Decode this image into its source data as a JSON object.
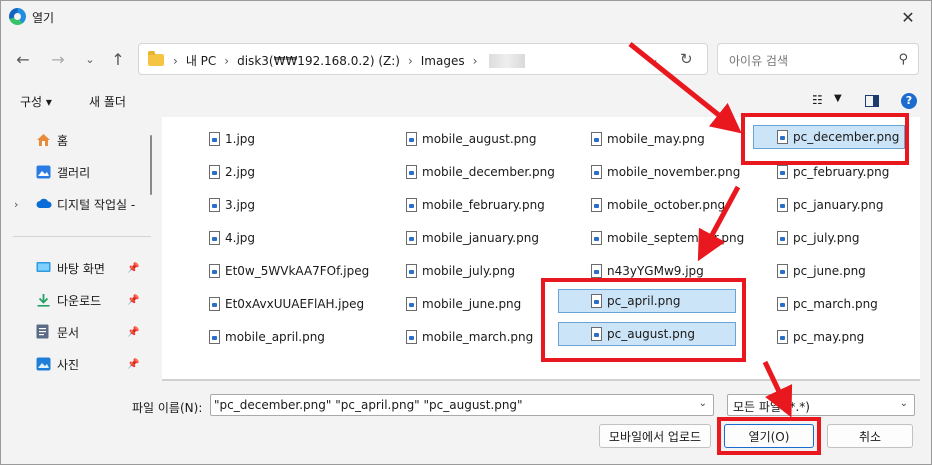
{
  "window": {
    "title": "열기"
  },
  "nav": {
    "crumbs": [
      "내 PC",
      "disk3(₩₩192.168.0.2) (Z:)",
      "Images"
    ],
    "search_placeholder": "아이유 검색"
  },
  "toolbar": {
    "organize": "구성 ▾",
    "new_folder": "새 폴더"
  },
  "sidebar": {
    "items": [
      {
        "label": "홈",
        "icon": "home-icon"
      },
      {
        "label": "갤러리",
        "icon": "gallery-icon"
      },
      {
        "label": "디지털 작업실 -",
        "icon": "cloud-icon"
      },
      {
        "label": "바탕 화면",
        "icon": "desktop-icon"
      },
      {
        "label": "다운로드",
        "icon": "download-icon"
      },
      {
        "label": "문서",
        "icon": "document-icon"
      },
      {
        "label": "사진",
        "icon": "pictures-icon"
      }
    ]
  },
  "files": [
    {
      "name": "1.jpg",
      "selected": false
    },
    {
      "name": "2.jpg",
      "selected": false
    },
    {
      "name": "3.jpg",
      "selected": false
    },
    {
      "name": "4.jpg",
      "selected": false
    },
    {
      "name": "Et0w_5WVkAA7FOf.jpeg",
      "selected": false
    },
    {
      "name": "Et0xAvxUUAEFlAH.jpeg",
      "selected": false
    },
    {
      "name": "mobile_april.png",
      "selected": false
    },
    {
      "name": "mobile_august.png",
      "selected": false
    },
    {
      "name": "mobile_december.png",
      "selected": false
    },
    {
      "name": "mobile_february.png",
      "selected": false
    },
    {
      "name": "mobile_january.png",
      "selected": false
    },
    {
      "name": "mobile_july.png",
      "selected": false
    },
    {
      "name": "mobile_june.png",
      "selected": false
    },
    {
      "name": "mobile_march.png",
      "selected": false
    },
    {
      "name": "mobile_may.png",
      "selected": false
    },
    {
      "name": "mobile_november.png",
      "selected": false
    },
    {
      "name": "mobile_october.png",
      "selected": false
    },
    {
      "name": "mobile_september.png",
      "selected": false
    },
    {
      "name": "n43yYGMw9.jpg",
      "selected": false
    },
    {
      "name": "pc_april.png",
      "selected": true
    },
    {
      "name": "pc_august.png",
      "selected": true
    },
    {
      "name": "pc_december.png",
      "selected": true
    },
    {
      "name": "pc_february.png",
      "selected": false
    },
    {
      "name": "pc_january.png",
      "selected": false
    },
    {
      "name": "pc_july.png",
      "selected": false
    },
    {
      "name": "pc_june.png",
      "selected": false
    },
    {
      "name": "pc_march.png",
      "selected": false
    },
    {
      "name": "pc_may.png",
      "selected": false
    }
  ],
  "footer": {
    "filename_label": "파일 이름(N):",
    "filename_value": "\"pc_december.png\" \"pc_april.png\" \"pc_august.png\"",
    "filetype_value": "모든 파일 (*.*)",
    "upload_label": "모바일에서 업로드",
    "open_label": "열기(O)",
    "cancel_label": "취소"
  },
  "colors": {
    "accent": "#1c6cd0",
    "selection": "#cce4f7",
    "annotation": "#e8181e"
  }
}
